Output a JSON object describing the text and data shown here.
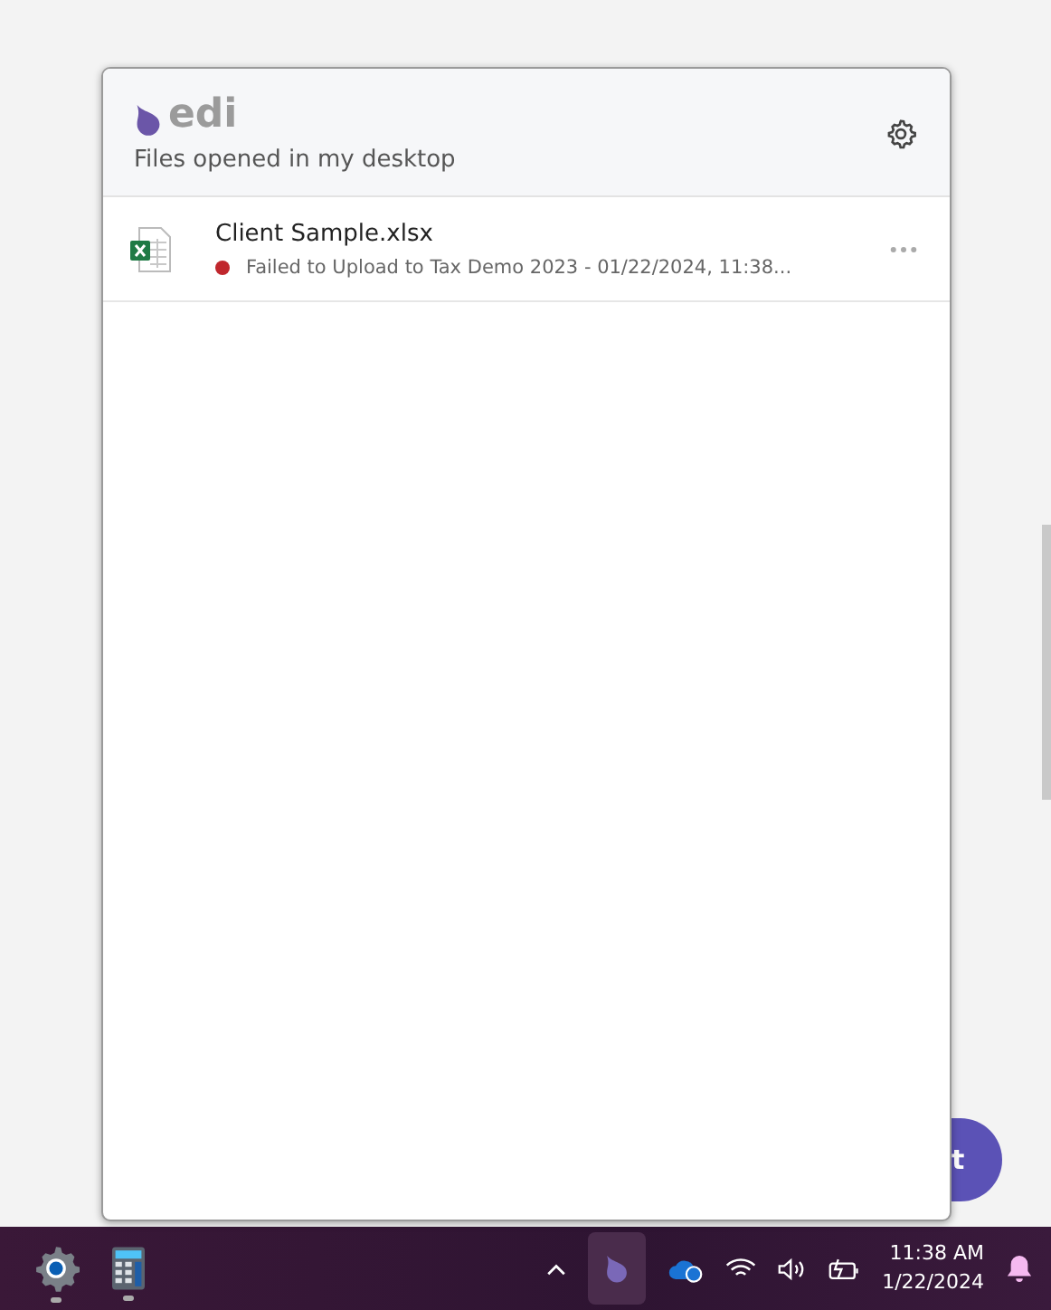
{
  "panel": {
    "logo": "edi",
    "subtitle": "Files opened in my desktop"
  },
  "files": [
    {
      "name": "Client Sample.xlsx",
      "status": "Failed to Upload to Tax Demo 2023 - 01/22/2024, 11:38...",
      "color": "#c0272d"
    }
  ],
  "background_button": {
    "label": "t"
  },
  "taskbar": {
    "time": "11:38 AM",
    "date": "1/22/2024"
  }
}
